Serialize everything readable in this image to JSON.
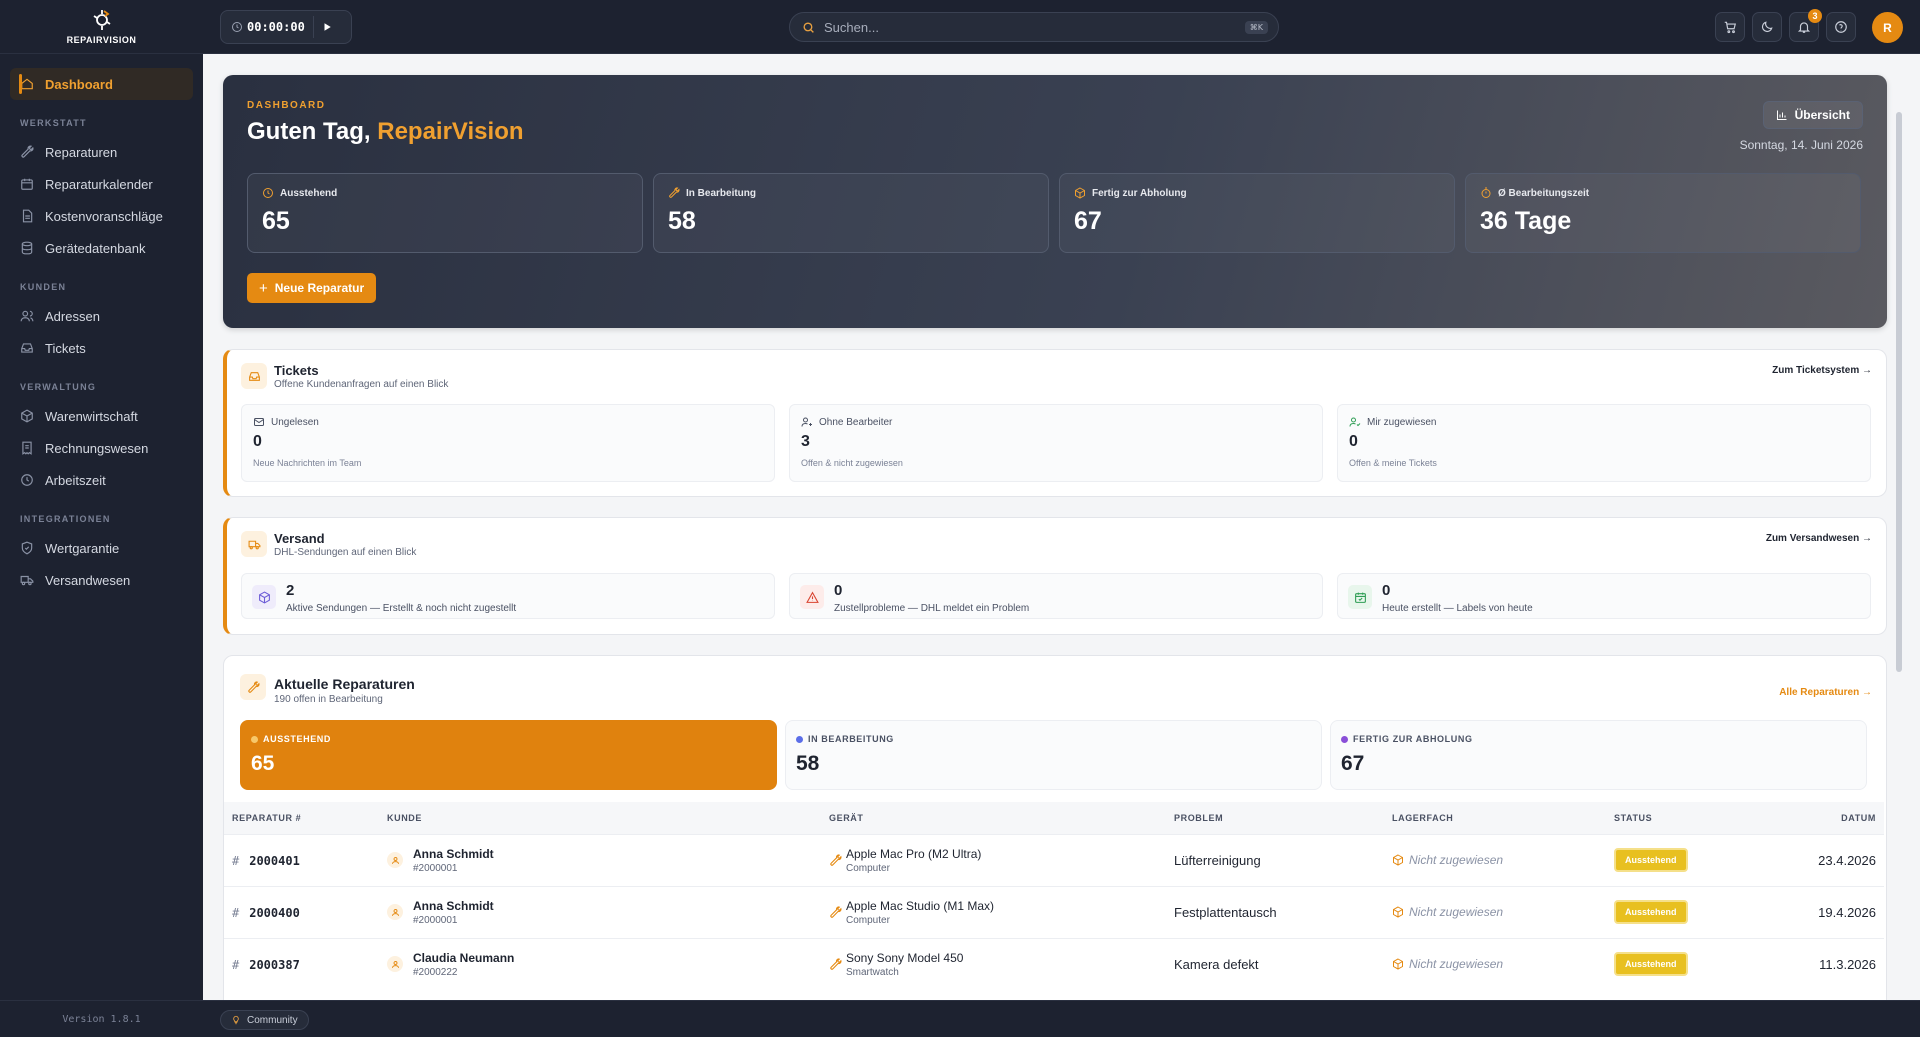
{
  "brand": {
    "name": "REPAIRVISION",
    "logo_icon": "repairvision-logo"
  },
  "sidebar": {
    "active": {
      "label": "Dashboard",
      "icon": "home-icon"
    },
    "sections": [
      {
        "title": "WERKSTATT",
        "items": [
          {
            "label": "Reparaturen",
            "icon": "wrench-icon"
          },
          {
            "label": "Reparaturkalender",
            "icon": "calendar-icon"
          },
          {
            "label": "Kostenvoranschläge",
            "icon": "document-icon"
          },
          {
            "label": "Gerätedatenbank",
            "icon": "database-icon"
          }
        ]
      },
      {
        "title": "KUNDEN",
        "items": [
          {
            "label": "Adressen",
            "icon": "users-icon"
          },
          {
            "label": "Tickets",
            "icon": "inbox-icon"
          }
        ]
      },
      {
        "title": "VERWALTUNG",
        "items": [
          {
            "label": "Warenwirtschaft",
            "icon": "package-icon"
          },
          {
            "label": "Rechnungswesen",
            "icon": "receipt-icon"
          },
          {
            "label": "Arbeitszeit",
            "icon": "clock-icon"
          }
        ]
      },
      {
        "title": "INTEGRATIONEN",
        "items": [
          {
            "label": "Wertgarantie",
            "icon": "shield-icon"
          },
          {
            "label": "Versandwesen",
            "icon": "truck-icon"
          }
        ]
      }
    ],
    "version": "Version 1.8.1"
  },
  "topbar": {
    "timer": "00:00:00",
    "search_placeholder": "Suchen...",
    "search_shortcut": "⌘K",
    "notifications_count": "3",
    "avatar_initial": "R"
  },
  "hero": {
    "label": "DASHBOARD",
    "greeting": "Guten Tag,",
    "company": "RepairVision",
    "overview_button": "Übersicht",
    "date": "Sonntag, 14. Juni 2026",
    "stats": [
      {
        "label": "Ausstehend",
        "value": "65",
        "icon": "clock-icon"
      },
      {
        "label": "In Bearbeitung",
        "value": "58",
        "icon": "wrench-icon"
      },
      {
        "label": "Fertig zur Abholung",
        "value": "67",
        "icon": "package-icon"
      },
      {
        "label": "Ø Bearbeitungszeit",
        "value": "36 Tage",
        "icon": "timer-icon"
      }
    ],
    "new_button": "Neue Reparatur"
  },
  "tickets": {
    "title": "Tickets",
    "subtitle": "Offene Kundenanfragen auf einen Blick",
    "link": "Zum Ticketsystem →",
    "boxes": [
      {
        "label": "Ungelesen",
        "value": "0",
        "sub": "Neue Nachrichten im Team",
        "icon": "mail-icon"
      },
      {
        "label": "Ohne Bearbeiter",
        "value": "3",
        "sub": "Offen & nicht zugewiesen",
        "icon": "user-plus-icon"
      },
      {
        "label": "Mir zugewiesen",
        "value": "0",
        "sub": "Offen & meine Tickets",
        "icon": "user-check-icon"
      }
    ]
  },
  "shipping": {
    "title": "Versand",
    "subtitle": "DHL-Sendungen auf einen Blick",
    "link": "Zum Versandwesen →",
    "boxes": [
      {
        "value": "2",
        "text": "Aktive Sendungen — Erstellt & noch nicht zugestellt",
        "icon": "cube-icon",
        "color": "#6b5bd6"
      },
      {
        "value": "0",
        "text": "Zustellprobleme — DHL meldet ein Problem",
        "icon": "warning-icon",
        "color": "#d9432f"
      },
      {
        "value": "0",
        "text": "Heute erstellt — Labels von heute",
        "icon": "calendar-check-icon",
        "color": "#2f9e55"
      }
    ]
  },
  "repairs": {
    "title": "Aktuelle Reparaturen",
    "subtitle": "190 offen in Bearbeitung",
    "link": "Alle Reparaturen →",
    "segments": [
      {
        "label": "AUSSTEHEND",
        "value": "65",
        "color": "#f7c86a"
      },
      {
        "label": "IN BEARBEITUNG",
        "value": "58",
        "color": "#5b6ee8"
      },
      {
        "label": "FERTIG ZUR ABHOLUNG",
        "value": "67",
        "color": "#8a4fd8"
      }
    ],
    "columns": [
      "REPARATUR #",
      "KUNDE",
      "GERÄT",
      "PROBLEM",
      "LAGERFACH",
      "STATUS",
      "DATUM"
    ],
    "rows": [
      {
        "id": "2000401",
        "customer": "Anna Schmidt",
        "customer_id": "#2000001",
        "device": "Apple Mac Pro (M2 Ultra)",
        "device_type": "Computer",
        "problem": "Lüfterreinigung",
        "storage": "Nicht zugewiesen",
        "status": "Ausstehend",
        "date": "23.4.2026"
      },
      {
        "id": "2000400",
        "customer": "Anna Schmidt",
        "customer_id": "#2000001",
        "device": "Apple Mac Studio (M1 Max)",
        "device_type": "Computer",
        "problem": "Festplattentausch",
        "storage": "Nicht zugewiesen",
        "status": "Ausstehend",
        "date": "19.4.2026"
      },
      {
        "id": "2000387",
        "customer": "Claudia Neumann",
        "customer_id": "#2000222",
        "device": "Sony Sony Model 450",
        "device_type": "Smartwatch",
        "problem": "Kamera defekt",
        "storage": "Nicht zugewiesen",
        "status": "Ausstehend",
        "date": "11.3.2026"
      }
    ]
  },
  "footer": {
    "community": "Community"
  },
  "colors": {
    "accent": "#e58a12",
    "sidebar_bg": "#1d2230",
    "status_pending": "#e8c020"
  }
}
